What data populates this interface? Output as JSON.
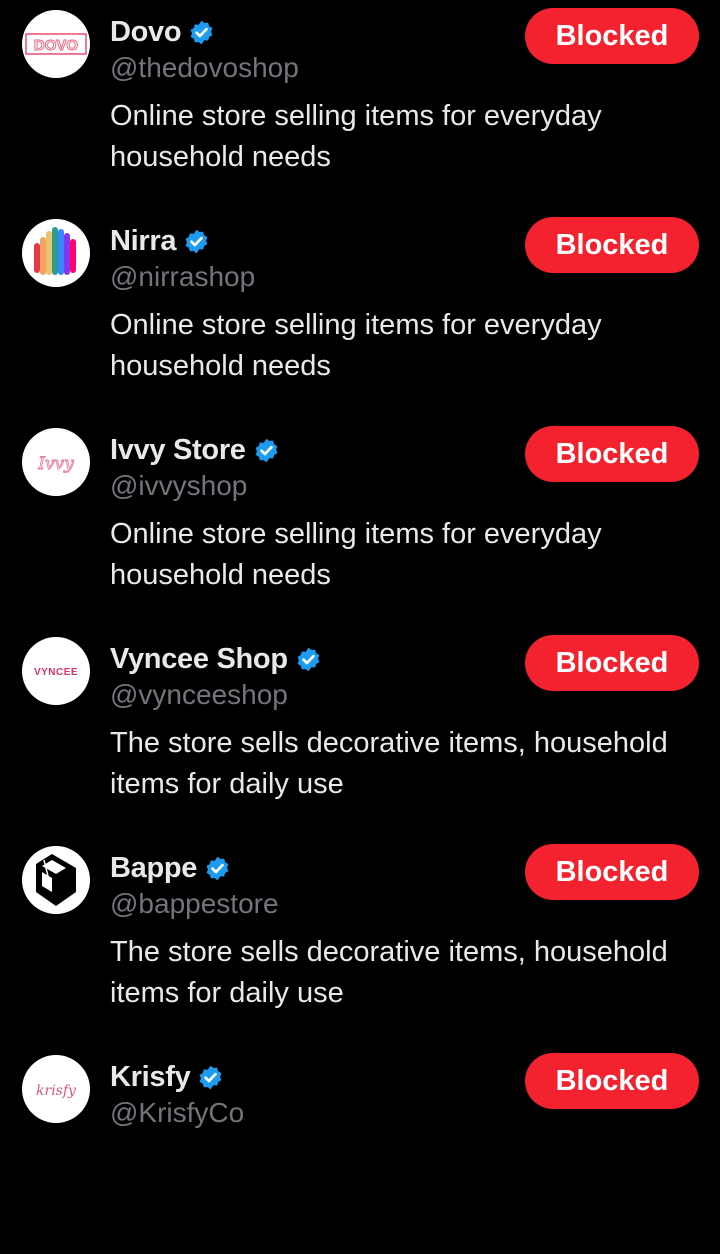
{
  "colors": {
    "background": "#000000",
    "text_primary": "#e7e9ea",
    "text_secondary": "#71767b",
    "blocked_button": "#f4212e",
    "verified_badge": "#1d9bf0"
  },
  "accounts": [
    {
      "name": "Dovo",
      "handle": "@thedovoshop",
      "bio": "Online store selling items for everyday household needs",
      "button_label": "Blocked",
      "avatar_icon": "dovo-logo-icon",
      "avatar_text": "DOVO",
      "verified": true
    },
    {
      "name": "Nirra",
      "handle": "@nirrashop",
      "bio": "Online store selling items for everyday household needs",
      "button_label": "Blocked",
      "avatar_icon": "nirra-rainbow-logo-icon",
      "verified": true
    },
    {
      "name": "Ivvy Store",
      "handle": "@ivvyshop",
      "bio": "Online store selling items for everyday household needs",
      "button_label": "Blocked",
      "avatar_icon": "ivvy-script-logo-icon",
      "avatar_text": "Ivvy",
      "verified": true
    },
    {
      "name": "Vyncee Shop",
      "handle": "@vynceeshop",
      "bio": "The store sells decorative items, household items for daily use",
      "button_label": "Blocked",
      "avatar_icon": "vyncee-logo-icon",
      "avatar_text": "VYNCEE",
      "verified": true
    },
    {
      "name": "Bappe",
      "handle": "@bappestore",
      "bio": "The store sells decorative items, household items for daily use",
      "button_label": "Blocked",
      "avatar_icon": "bappe-geometric-logo-icon",
      "verified": true
    },
    {
      "name": "Krisfy",
      "handle": "@KrisfyCo",
      "bio": "",
      "button_label": "Blocked",
      "avatar_icon": "krisfy-script-logo-icon",
      "avatar_text": "krisfy",
      "verified": true
    }
  ]
}
